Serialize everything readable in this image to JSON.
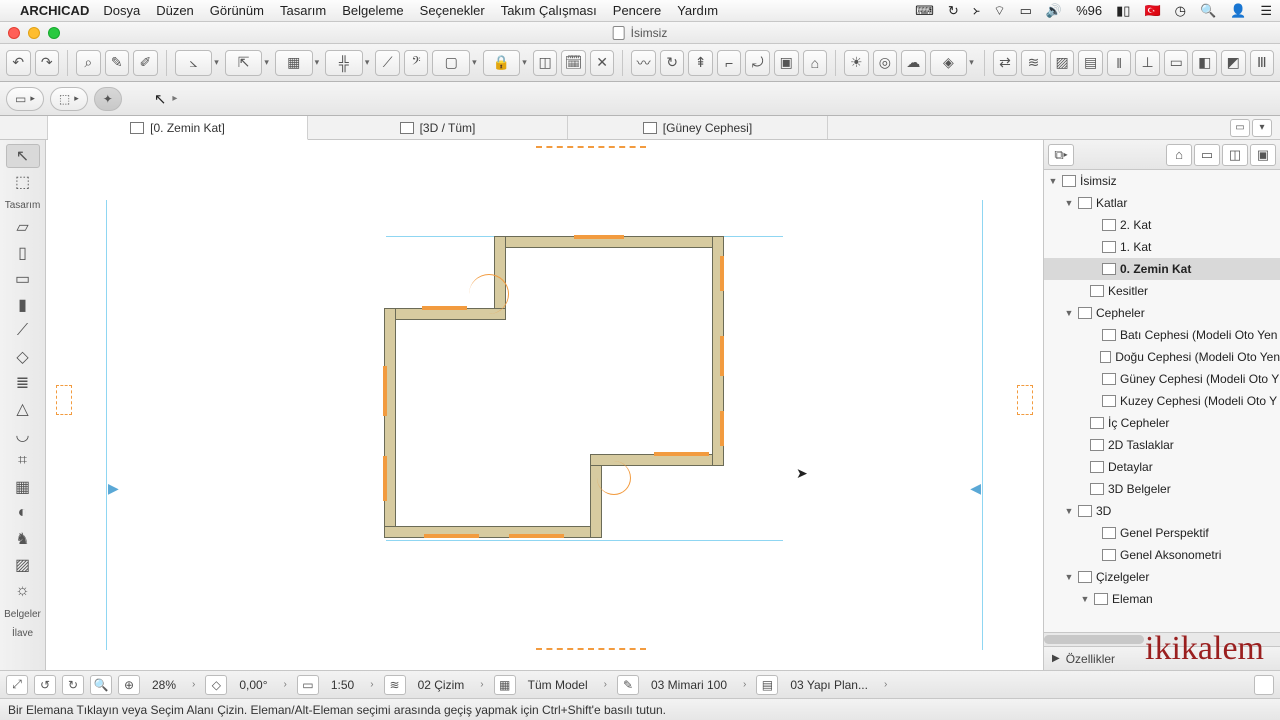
{
  "menubar": {
    "app": "ARCHICAD",
    "items": [
      "Dosya",
      "Düzen",
      "Görünüm",
      "Tasarım",
      "Belgeleme",
      "Seçenekler",
      "Takım Çalışması",
      "Pencere",
      "Yardım"
    ],
    "battery": "%96"
  },
  "titlebar": {
    "doc": "İsimsiz"
  },
  "tabs": {
    "items": [
      {
        "label": "[0. Zemin Kat]"
      },
      {
        "label": "[3D / Tüm]"
      },
      {
        "label": "[Güney Cephesi]"
      }
    ]
  },
  "palette": {
    "section_design": "Tasarım",
    "section_docs": "Belgeler",
    "section_extra": "İlave"
  },
  "navigator": {
    "root": "İsimsiz",
    "floors_group": "Katlar",
    "floors": [
      "2. Kat",
      "1. Kat",
      "0. Zemin Kat"
    ],
    "selected_floor": "0. Zemin Kat",
    "sections": "Kesitler",
    "elevations_group": "Cepheler",
    "elevations": [
      "Batı Cephesi (Modeli Oto Yen",
      "Doğu Cephesi (Modeli Oto Yen",
      "Güney Cephesi (Modeli Oto Y",
      "Kuzey Cephesi (Modeli Oto Y"
    ],
    "int_elev": "İç Cepheler",
    "worksheets": "2D Taslaklar",
    "details": "Detaylar",
    "docs3d": "3D Belgeler",
    "three_d": "3D",
    "three_d_items": [
      "Genel Perspektif",
      "Genel Aksonometri"
    ],
    "schedules": "Çizelgeler",
    "schedule_sub": "Eleman",
    "properties": "Özellikler"
  },
  "footer": {
    "zoom": "28%",
    "angle": "0,00°",
    "scale": "1:50",
    "layer": "02 Çizim",
    "model": "Tüm Model",
    "penset": "03 Mimari 100",
    "plan": "03 Yapı Plan..."
  },
  "status": "Bir Elemana Tıklayın veya Seçim Alanı Çizin.   Eleman/Alt-Eleman seçimi arasında geçiş yapmak için Ctrl+Shift'e basılı tutun."
}
